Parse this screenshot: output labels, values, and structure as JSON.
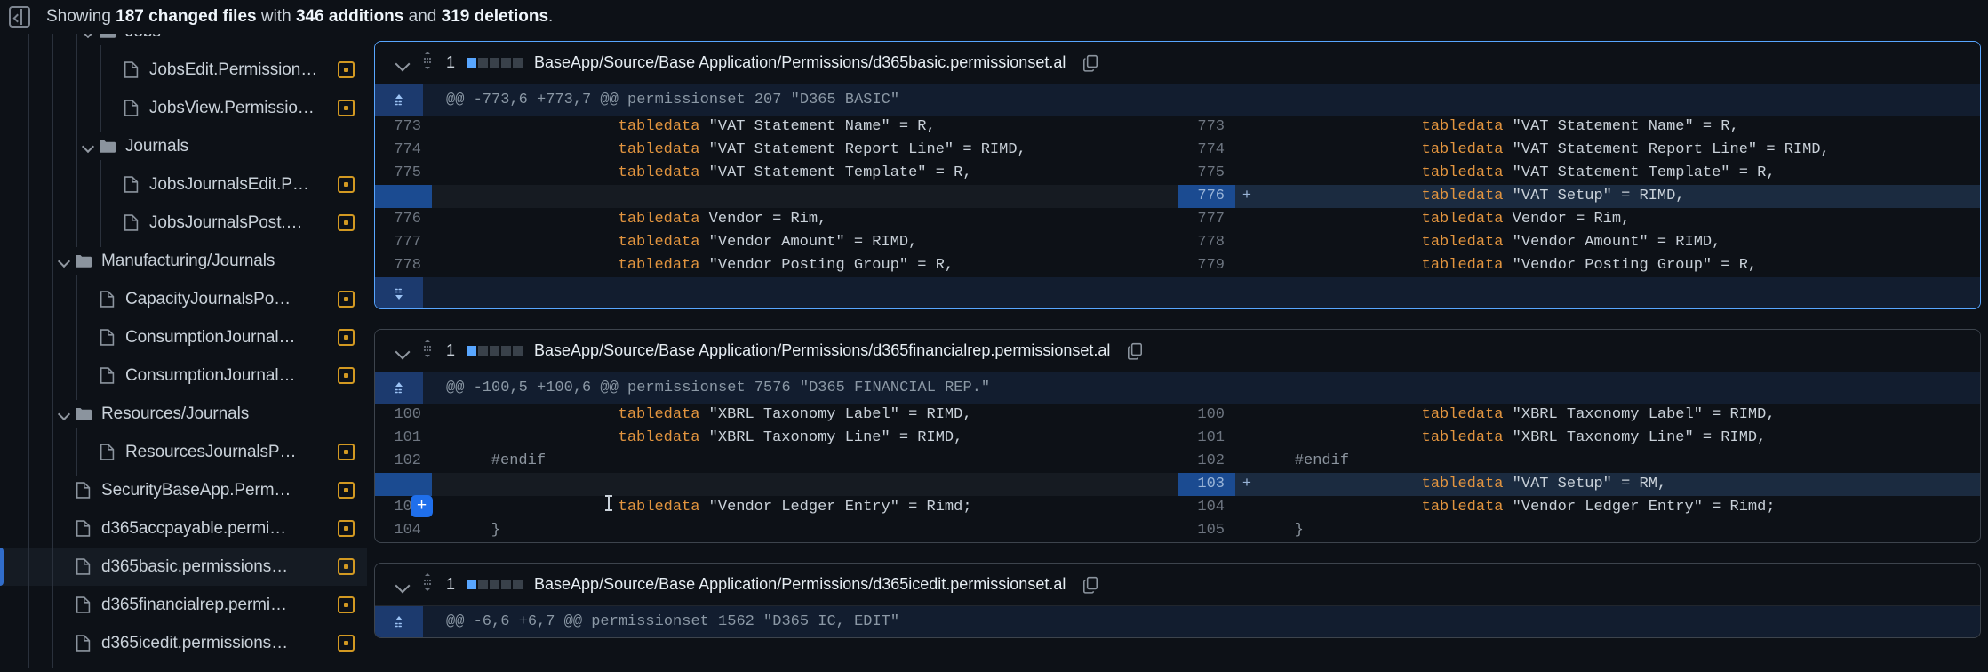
{
  "banner": {
    "icon": "sidebar-toggle-icon",
    "prefix": "Showing ",
    "files": "187 changed files",
    "mid": " with ",
    "additions": "346 additions",
    "mid2": " and ",
    "deletions": "319 deletions",
    "suffix": "."
  },
  "sidebar": {
    "items": [
      {
        "type": "folder",
        "label": "Jobs",
        "depth": 2,
        "expanded": true,
        "badge": false,
        "clipped": true
      },
      {
        "type": "file",
        "label": "JobsEdit.Permission…",
        "depth": 3,
        "badge": true
      },
      {
        "type": "file",
        "label": "JobsView.Permissio…",
        "depth": 3,
        "badge": true
      },
      {
        "type": "folder",
        "label": "Journals",
        "depth": 2,
        "expanded": true,
        "badge": false
      },
      {
        "type": "file",
        "label": "JobsJournalsEdit.P…",
        "depth": 3,
        "badge": true
      },
      {
        "type": "file",
        "label": "JobsJournalsPost.…",
        "depth": 3,
        "badge": true
      },
      {
        "type": "folder",
        "label": "Manufacturing/Journals",
        "depth": 1,
        "expanded": true,
        "badge": false
      },
      {
        "type": "file",
        "label": "CapacityJournalsPo…",
        "depth": 2,
        "badge": true
      },
      {
        "type": "file",
        "label": "ConsumptionJournal…",
        "depth": 2,
        "badge": true
      },
      {
        "type": "file",
        "label": "ConsumptionJournal…",
        "depth": 2,
        "badge": true
      },
      {
        "type": "folder",
        "label": "Resources/Journals",
        "depth": 1,
        "expanded": true,
        "badge": false
      },
      {
        "type": "file",
        "label": "ResourcesJournalsP…",
        "depth": 2,
        "badge": true
      },
      {
        "type": "file",
        "label": "SecurityBaseApp.Perm…",
        "depth": 1,
        "badge": true
      },
      {
        "type": "file",
        "label": "d365accpayable.permi…",
        "depth": 1,
        "badge": true
      },
      {
        "type": "file",
        "label": "d365basic.permissions…",
        "depth": 1,
        "badge": true,
        "selected": true
      },
      {
        "type": "file",
        "label": "d365financialrep.permi…",
        "depth": 1,
        "badge": true
      },
      {
        "type": "file",
        "label": "d365icedit.permissions…",
        "depth": 1,
        "badge": true
      }
    ]
  },
  "files": [
    {
      "comment_count": "1",
      "stat_blocks": [
        "mod",
        "non",
        "non",
        "non",
        "non"
      ],
      "path": "BaseApp/Source/Base Application/Permissions/d365basic.permissionset.al",
      "focused": true,
      "expand_up": true,
      "expand_down": true,
      "hunk_header": "@@ -773,6 +773,7 @@ permissionset 207 \"D365 BASIC\"",
      "rows": [
        {
          "kind": "ctx",
          "lno_l": "773",
          "lno_r": "773",
          "kw": "tabledata",
          "rest": " \"VAT Statement Name\" = R,"
        },
        {
          "kind": "ctx",
          "lno_l": "774",
          "lno_r": "774",
          "kw": "tabledata",
          "rest": " \"VAT Statement Report Line\" = RIMD,"
        },
        {
          "kind": "ctx",
          "lno_l": "775",
          "lno_r": "775",
          "kw": "tabledata",
          "rest": " \"VAT Statement Template\" = R,"
        },
        {
          "kind": "added",
          "lno_l": "",
          "lno_r": "776",
          "marker": "+",
          "kw": "tabledata",
          "rest": " \"VAT Setup\" = RIMD,"
        },
        {
          "kind": "ctx",
          "lno_l": "776",
          "lno_r": "777",
          "kw": "tabledata",
          "rest": " Vendor = Rim,"
        },
        {
          "kind": "ctx",
          "lno_l": "777",
          "lno_r": "778",
          "kw": "tabledata",
          "rest": " \"Vendor Amount\" = RIMD,"
        },
        {
          "kind": "ctx",
          "lno_l": "778",
          "lno_r": "779",
          "kw": "tabledata",
          "rest": " \"Vendor Posting Group\" = R,"
        }
      ]
    },
    {
      "comment_count": "1",
      "stat_blocks": [
        "mod",
        "non",
        "non",
        "non",
        "non"
      ],
      "path": "BaseApp/Source/Base Application/Permissions/d365financialrep.permissionset.al",
      "focused": false,
      "expand_up": true,
      "expand_down": false,
      "hunk_header": "@@ -100,5 +100,6 @@ permissionset 7576 \"D365 FINANCIAL REP.\"",
      "add_button": "+",
      "rows": [
        {
          "kind": "ctx",
          "lno_l": "100",
          "lno_r": "100",
          "kw": "tabledata",
          "rest": " \"XBRL Taxonomy Label\" = RIMD,"
        },
        {
          "kind": "ctx",
          "lno_l": "101",
          "lno_r": "101",
          "kw": "tabledata",
          "rest": " \"XBRL Taxonomy Line\" = RIMD,"
        },
        {
          "kind": "ctx",
          "lno_l": "102",
          "lno_r": "102",
          "plain": "    #endif"
        },
        {
          "kind": "added",
          "lno_l": "",
          "lno_r": "103",
          "marker": "+",
          "kw": "tabledata",
          "rest": " \"VAT Setup\" = RM,"
        },
        {
          "kind": "ctx",
          "lno_l": "103",
          "lno_r": "104",
          "kw": "tabledata",
          "rest": " \"Vendor Ledger Entry\" = Rimd;",
          "hover": true
        },
        {
          "kind": "ctx",
          "lno_l": "104",
          "lno_r": "105",
          "plain": "    }"
        }
      ]
    },
    {
      "comment_count": "1",
      "stat_blocks": [
        "mod",
        "non",
        "non",
        "non",
        "non"
      ],
      "path": "BaseApp/Source/Base Application/Permissions/d365icedit.permissionset.al",
      "focused": false,
      "expand_up": true,
      "expand_down": false,
      "hunk_header": "@@ -6,6 +6,7 @@ permissionset 1562 \"D365 IC, EDIT\"",
      "rows": []
    }
  ],
  "colors": {
    "background": "#0d1117",
    "accent": "#58a6ff",
    "added_line": "#1b2b40",
    "badge_modified": "#d29922",
    "keyword": "#e3953f",
    "add_button": "#1f6feb"
  }
}
